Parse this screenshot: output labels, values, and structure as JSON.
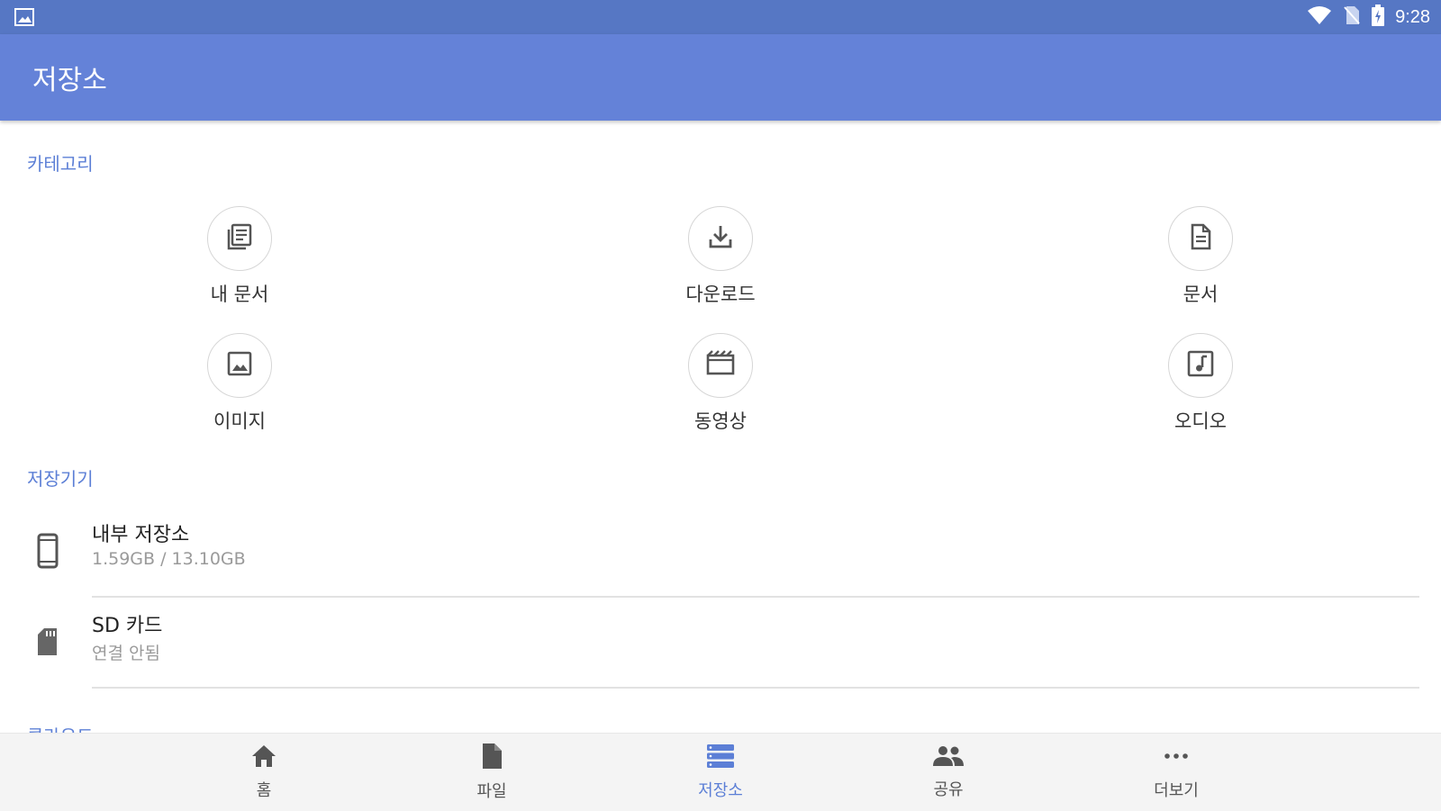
{
  "status_bar": {
    "time": "9:28",
    "icons": [
      "image-icon",
      "wifi-icon",
      "no-sim-icon",
      "battery-charging-icon"
    ]
  },
  "app_bar": {
    "title": "저장소"
  },
  "categories": {
    "header": "카테고리",
    "items": [
      {
        "label": "내 문서",
        "icon": "my-documents-icon"
      },
      {
        "label": "다운로드",
        "icon": "download-icon"
      },
      {
        "label": "문서",
        "icon": "document-icon"
      },
      {
        "label": "이미지",
        "icon": "image-icon"
      },
      {
        "label": "동영상",
        "icon": "video-icon"
      },
      {
        "label": "오디오",
        "icon": "audio-icon"
      }
    ]
  },
  "storage": {
    "header": "저장기기",
    "items": [
      {
        "name": "내부 저장소",
        "sub": "1.59GB / 13.10GB",
        "icon": "phone-icon"
      },
      {
        "name": "SD 카드",
        "sub": "연결 안됨",
        "icon": "sd-card-icon"
      }
    ]
  },
  "cloud": {
    "header": "클라우드"
  },
  "bottom_nav": {
    "items": [
      {
        "label": "홈",
        "icon": "home-icon",
        "active": false
      },
      {
        "label": "파일",
        "icon": "file-icon",
        "active": false
      },
      {
        "label": "저장소",
        "icon": "storage-icon",
        "active": true
      },
      {
        "label": "공유",
        "icon": "share-people-icon",
        "active": false
      },
      {
        "label": "더보기",
        "icon": "more-icon",
        "active": false
      }
    ]
  },
  "colors": {
    "status_bar": "#5677c4",
    "app_bar": "#6482d8",
    "accent": "#5c7fd6",
    "icon_gray": "#555555"
  }
}
